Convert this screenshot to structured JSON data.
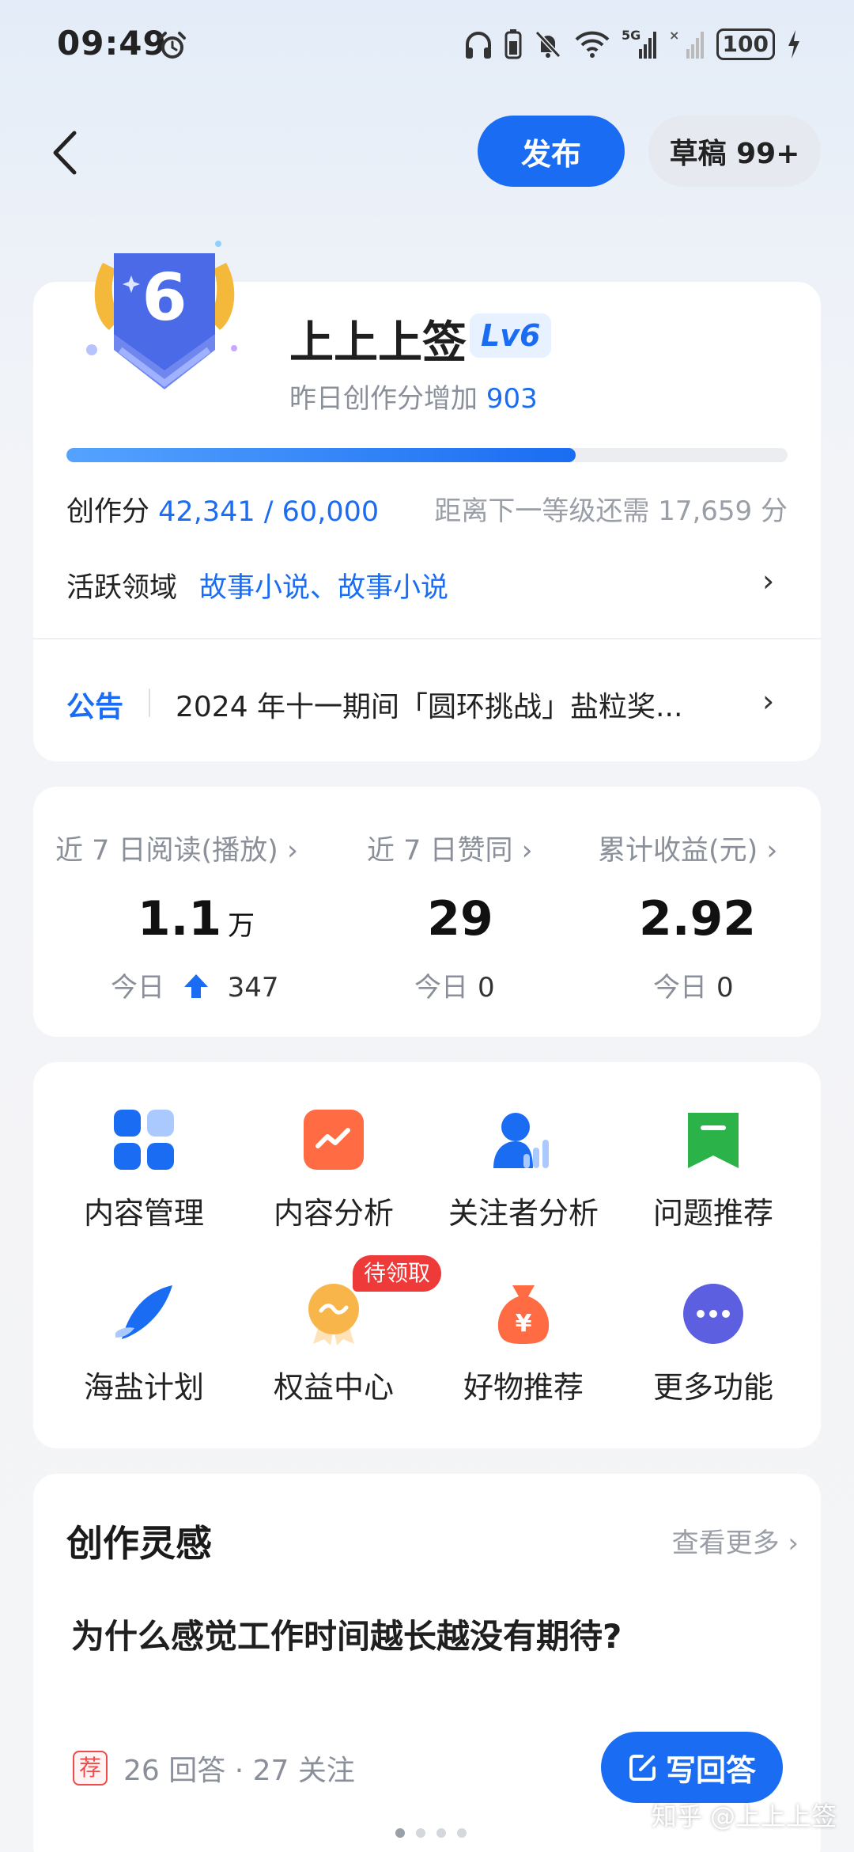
{
  "status_bar": {
    "time": "09:49",
    "network": "5G",
    "battery": "100",
    "icons": [
      "alarm-icon",
      "headphones-icon",
      "battery-saver-icon",
      "mute-icon",
      "wifi-icon",
      "signal-icon",
      "charging-icon"
    ]
  },
  "header": {
    "publish_label": "发布",
    "draft_label": "草稿 99+"
  },
  "profile": {
    "level_badge": "6",
    "username": "上上上签",
    "level": "Lv6",
    "yesterday_text": "昨日创作分增加",
    "yesterday_value": "903",
    "score_label": "创作分",
    "score_value": "42,341 / 60,000",
    "score_progress": 0.7057,
    "next_level_text": "距离下一等级还需 17,659 分",
    "domain_label": "活跃领域",
    "domain_value": "故事小说、故事小说",
    "chevron": "›",
    "notice_tag": "公告",
    "notice_text": "2024 年十一期间「圆环挑战」盐粒奖..."
  },
  "stats": [
    {
      "label": "近 7 日阅读(播放) ›",
      "value": "1.1",
      "unit": "万",
      "today_label": "今日",
      "today_value": "347",
      "trend": "up"
    },
    {
      "label": "近 7 日赞同 ›",
      "value": "29",
      "unit": "",
      "today_label": "今日",
      "today_value": "0"
    },
    {
      "label": "累计收益(元) ›",
      "value": "2.92",
      "unit": "",
      "today_label": "今日",
      "today_value": "0"
    }
  ],
  "tools": [
    {
      "label": "内容管理",
      "icon": "grid-icon"
    },
    {
      "label": "内容分析",
      "icon": "trend-chart-icon"
    },
    {
      "label": "关注者分析",
      "icon": "follower-chart-icon"
    },
    {
      "label": "问题推荐",
      "icon": "bookmark-icon"
    },
    {
      "label": "海盐计划",
      "icon": "feather-icon"
    },
    {
      "label": "权益中心",
      "icon": "medal-icon",
      "badge": "待领取"
    },
    {
      "label": "好物推荐",
      "icon": "money-bag-icon"
    },
    {
      "label": "更多功能",
      "icon": "more-icon"
    }
  ],
  "inspiration": {
    "title": "创作灵感",
    "more": "查看更多 ›",
    "question": "为什么感觉工作时间越长越没有期待?",
    "rec_tag": "荐",
    "meta": "26 回答 · 27 关注",
    "write_label": "写回答",
    "page_count": 4,
    "active_page": 1
  },
  "watermark": "知乎 @上上上签",
  "colors": {
    "brand_blue": "#1a6cf2",
    "alert_red": "#ef3a3a"
  }
}
